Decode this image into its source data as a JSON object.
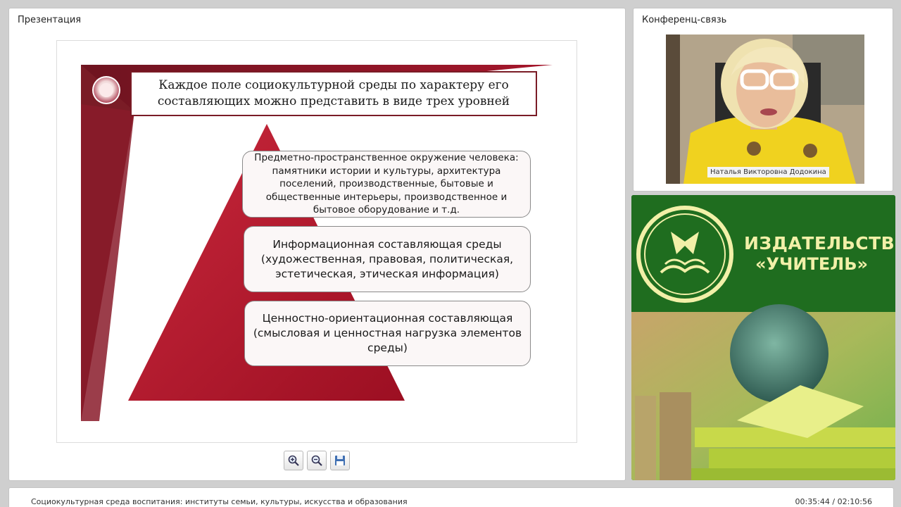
{
  "presentation_panel": {
    "title": "Презентация"
  },
  "slide": {
    "title": "Каждое поле социокультурной среды по характеру его составляющих можно представить в виде трех уровней",
    "levels": [
      {
        "text": "Предметно-пространственное окружение человека: памятники истории и культуры, архитектура поселений, производственные, бытовые и общественные интерьеры, производственное и бытовое оборудование и т.д."
      },
      {
        "text": "Информационная составляющая среды (художественная, правовая, политическая, эстетическая, этическая информация)"
      },
      {
        "text": "Ценностно-ориентационная составляющая (смысловая и ценностная нагрузка элементов среды)"
      }
    ],
    "colors": {
      "dark_red": "#7a1c26",
      "red": "#b11f34",
      "deep": "#8c0f20"
    }
  },
  "toolbar": {
    "zoom_in_icon": "zoom-in-icon",
    "zoom_out_icon": "zoom-out-icon",
    "save_icon": "floppy-save-icon"
  },
  "conference_panel": {
    "title": "Конференц-связь",
    "participant_name": "Наталья Викторовна Додокина"
  },
  "ad": {
    "line1": "ИЗДАТЕЛЬСТВО",
    "line2": "«УЧИТЕЛЬ»",
    "colors": {
      "green": "#1f6d1f",
      "text": "#f2f0a8"
    }
  },
  "bottom_bar": {
    "title": "Социокультурная среда воспитания: институты семьи, культуры, искусства и образования",
    "time": "00:35:44 / 02:10:56"
  }
}
